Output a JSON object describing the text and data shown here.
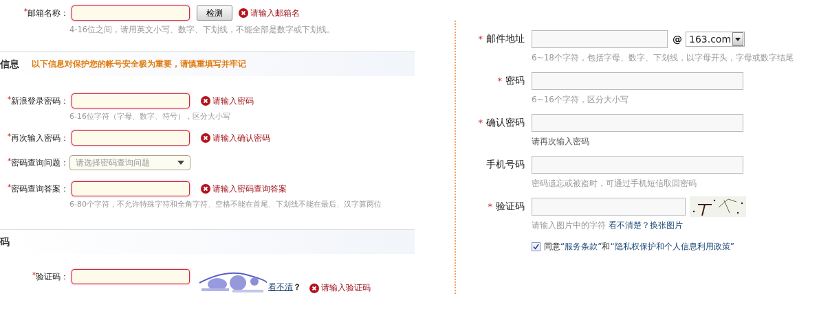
{
  "left": {
    "email_row": {
      "mark": "*",
      "label": "邮箱名称：",
      "button": "检测",
      "error": "请输入邮箱名",
      "hint": "4-16位之间，请用英文小写、数字、下划线，不能全部是数字或下划线。"
    },
    "section_1": {
      "title": "信息",
      "note": "以下信息对保护您的帐号安全极为重要，请慎重填写并牢记"
    },
    "fields": [
      {
        "kind": "input",
        "mark": "*",
        "label": "新浪登录密码：",
        "error": "请输入密码",
        "hint": "6-16位字符（字母、数字、符号），区分大小写"
      },
      {
        "kind": "input",
        "mark": "*",
        "label": "再次输入密码：",
        "error": "请输入确认密码"
      },
      {
        "kind": "select",
        "mark": "*",
        "label": "密码查询问题：",
        "placeholder": "请选择密码查询问题"
      },
      {
        "kind": "input",
        "mark": "*",
        "label": "密码查询答案：",
        "error": "请输入密码查询答案",
        "hint": "6-80个字符，不允许特殊字符和全角字符、空格不能在首尾、下划线不能在最后、汉字算两位"
      }
    ],
    "section_2": {
      "title": "码"
    },
    "captcha": {
      "mark": "*",
      "label": "验证码：",
      "link": "看不清",
      "question": "？",
      "error": "请输入验证码"
    }
  },
  "right": {
    "fields": [
      {
        "kind": "email",
        "mark": "*",
        "label": "邮件地址",
        "at": "@",
        "domain": "163.com",
        "hint": "6~18个字符，包括字母、数字、下划线，以字母开头，字母或数字结尾"
      },
      {
        "kind": "input",
        "mark": "*",
        "label": "密码",
        "hint": "6~16个字符，区分大小写"
      },
      {
        "kind": "input",
        "mark": "*",
        "label": "确认密码",
        "hint": "请再次输入密码"
      },
      {
        "kind": "input",
        "label": "手机号码",
        "hint": "密码遗忘或被盗时，可通过手机短信取回密码"
      },
      {
        "kind": "captcha",
        "mark": "*",
        "label": "验证码",
        "hint": "请输入图片中的字符",
        "link": "看不清楚？换张图片"
      }
    ],
    "agree": {
      "checked": true,
      "text_1": "同意",
      "link_1": "“服务条款”",
      "text_2": "和",
      "link_2": "“隐私权保护和个人信息利用政策”"
    }
  }
}
